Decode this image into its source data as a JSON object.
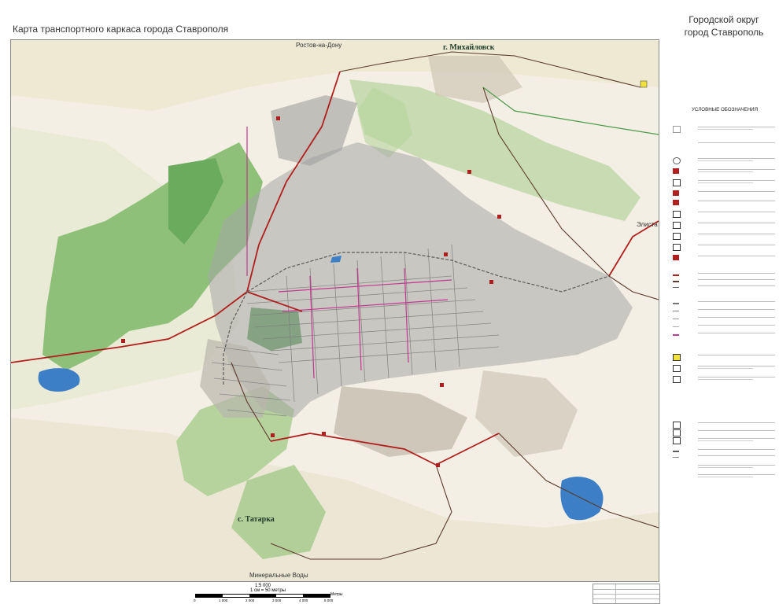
{
  "header": {
    "title": "Карта транспортного каркаса города Ставрополя",
    "district_line1": "Городской округ",
    "district_line2": "город Ставрополь"
  },
  "map": {
    "labels": {
      "mikhaylovsk": "г. Михайловск",
      "tatarka": "с. Татарка",
      "rostov": "Ростов-на-Дону",
      "elista": "Элиста",
      "mineralnye": "Минеральные Воды"
    }
  },
  "legend": {
    "title": "УСЛОВНЫЕ ОБОЗНАЧЕНИЯ"
  },
  "scale": {
    "ratio": "1:5 000",
    "cm": "1 см = 50 метры",
    "unit": "Метры",
    "ticks": [
      "0",
      "1 000",
      "2 000",
      "3 000",
      "4 000",
      "5 000"
    ]
  },
  "colors": {
    "background": "#f3efe4",
    "forest": "#8ec07a",
    "forest_dark": "#5ea15a",
    "built": "#a6a6a6",
    "water": "#3d7fc6",
    "federal_road": "#b11e1e",
    "rail": "#5c5c5c"
  }
}
